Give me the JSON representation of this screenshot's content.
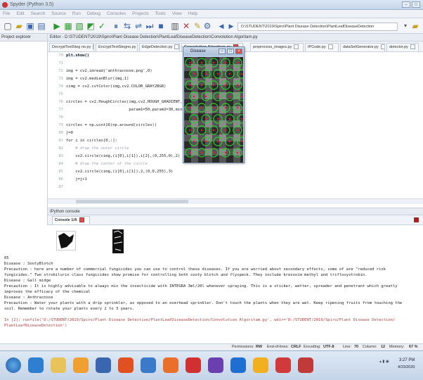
{
  "window": {
    "title": "Spyder (Python 3.5)"
  },
  "menu": [
    "File",
    "Edit",
    "Search",
    "Source",
    "Run",
    "Debug",
    "Consoles",
    "Projects",
    "Tools",
    "View",
    "Help"
  ],
  "toolbar": {
    "path": "D:\\STUDENT\\2019\\Spiro\\Plant Disease Detection\\PlantLeafDiseaseDetection"
  },
  "left_pane": {
    "title": "Project explorer"
  },
  "editor": {
    "header": "Editor - D:\\STUDENT\\2019\\Spiro\\Plant Disease Detection\\PlantLeafDiseaseDetection\\Convolution Algoritam.py",
    "tabs": [
      {
        "label": "DecryptTextSteg no.py",
        "active": false
      },
      {
        "label": "EncryptTextStegno.py",
        "active": false
      },
      {
        "label": "EdgeDetection.py",
        "active": false
      },
      {
        "label": "Convolution Algoritam.py",
        "active": true
      },
      {
        "label": "preprocess_images.py",
        "active": false
      },
      {
        "label": "IPCode.py",
        "active": false
      },
      {
        "label": "dataSetGenerator.py",
        "active": false
      },
      {
        "label": "detector.py",
        "active": false
      }
    ],
    "lines": [
      {
        "n": "70",
        "text": "plt.show()",
        "cur": true
      },
      {
        "n": "71",
        "text": ""
      },
      {
        "n": "72",
        "text": "img = cv2.imread('anthracnose.png',0)"
      },
      {
        "n": "73",
        "text": "img = cv2.medianBlur(img,1)"
      },
      {
        "n": "74",
        "text": "cimg = cv2.cvtColor(img,cv2.COLOR_GRAY2BGR)"
      },
      {
        "n": "75",
        "text": ""
      },
      {
        "n": "76",
        "text": "circles = cv2.HoughCircles(img,cv2.HOUGH_GRADIENT,1,20,"
      },
      {
        "n": "77",
        "text": "                           param1=50,param2=30,minRadius="
      },
      {
        "n": "78",
        "text": ""
      },
      {
        "n": "79",
        "text": "circles = np.uint16(np.around(circles))"
      },
      {
        "n": "80",
        "text": "j=0"
      },
      {
        "n": "81",
        "text": "for i in circles[0,:]:"
      },
      {
        "n": "82",
        "text": "    # draw the outer circle",
        "comment": true
      },
      {
        "n": "83",
        "text": "    cv2.circle(cimg,(i[0],i[1]),i[2],(0,255,0),2)"
      },
      {
        "n": "84",
        "text": "    # draw the center of the circle",
        "comment": true
      },
      {
        "n": "85",
        "text": "    cv2.circle(cimg,(i[0],i[1]),2,(0,0,255),3)"
      },
      {
        "n": "86",
        "text": "    j=j+1"
      },
      {
        "n": "87",
        "text": ""
      }
    ]
  },
  "figure_window": {
    "title": "Disease"
  },
  "console": {
    "header": "IPython console",
    "tab": "Console 1/A",
    "lines": [
      {
        "text": "65"
      },
      {
        "text": "Disease : SootyBlotch"
      },
      {
        "text": "Precaution : here are a number of commercial fungicides you can use to control these diseases. If you are worried about secondary effects, some of are \"reduced risk"
      },
      {
        "text": "fungicides.\" Two strobilurin class fungicides show promise for controlling both sooty blotch and flyspeck. They include kresoxim methyl and trifloxystrobin."
      },
      {
        "text": "Disease : Gall midge"
      },
      {
        "text": "Precaution : It is highly advisable to always mix the insecticide with INTEGRA 3ml/20l whenever spraying. This is a sticker, wetter, spreader and penetrant which greatly"
      },
      {
        "text": "improves the efficacy of the chemical"
      },
      {
        "text": "Disease : Anthracnose"
      },
      {
        "text": "Precaution : Water your plants with a drip sprinkler, as opposed to an overhead sprinkler. Don't touch the plants when they are wet. Keep ripening fruits from touching the"
      },
      {
        "text": "soil. Remember to rotate your plants every 2 to 3 years."
      },
      {
        "text": ""
      },
      {
        "text": "In [2]: runfile('D:/STUDENT/2019/Spiro/Plant Disease Detection/PlantLeafDiseaseDetection/Convolution Algoritam.py', wdir='D:/STUDENT/2019/Spiro/Plant Disease Detection/",
        "prompt": true
      },
      {
        "text": "PlantLeafDiseaseDetection')",
        "prompt": true
      }
    ]
  },
  "status": {
    "permissions_label": "Permissions:",
    "permissions": "RW",
    "eol_label": "End-of-lines:",
    "eol": "CRLF",
    "encoding_label": "Encoding:",
    "encoding": "UTF-8",
    "line_label": "Line:",
    "line": "70",
    "column_label": "Column:",
    "column": "12",
    "memory_label": "Memory:",
    "memory": "67 %"
  },
  "taskbar": {
    "time": "3:27 PM",
    "date": "4/23/2020"
  },
  "colors": {
    "accent": "#d94b3a",
    "console_prompt": "#2f7a2f",
    "path_string": "#b04040"
  }
}
